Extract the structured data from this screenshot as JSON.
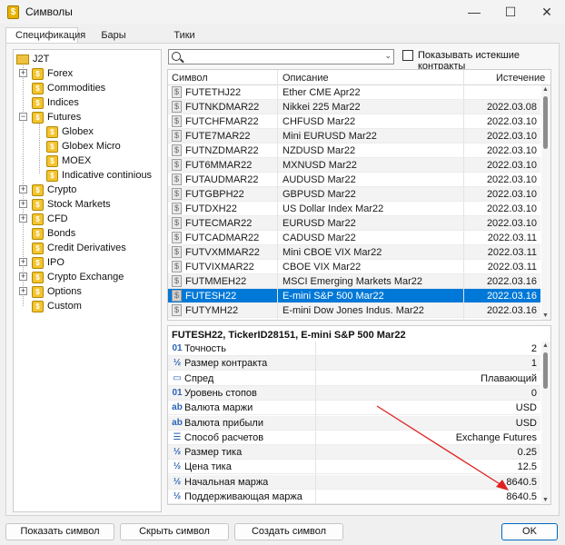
{
  "window": {
    "title": "Символы",
    "minimize": "—",
    "maximize": "☐",
    "close": "✕"
  },
  "tabs": [
    {
      "label": "Спецификация",
      "active": true
    },
    {
      "label": "Бары",
      "active": false
    },
    {
      "label": "Тики",
      "active": false
    }
  ],
  "tree": {
    "root": "J2T",
    "items": [
      {
        "label": "Forex",
        "expander": "+"
      },
      {
        "label": "Commodities",
        "expander": ""
      },
      {
        "label": "Indices",
        "expander": ""
      },
      {
        "label": "Futures",
        "expander": "−"
      },
      {
        "label": "Globex",
        "expander": "",
        "child": true
      },
      {
        "label": "Globex Micro",
        "expander": "",
        "child": true
      },
      {
        "label": "MOEX",
        "expander": "",
        "child": true
      },
      {
        "label": "Indicative continious",
        "expander": "",
        "child": true
      },
      {
        "label": "Crypto",
        "expander": "+"
      },
      {
        "label": "Stock Markets",
        "expander": "+"
      },
      {
        "label": "CFD",
        "expander": "+"
      },
      {
        "label": "Bonds",
        "expander": ""
      },
      {
        "label": "Credit Derivatives",
        "expander": ""
      },
      {
        "label": "IPO",
        "expander": "+"
      },
      {
        "label": "Crypto Exchange",
        "expander": "+"
      },
      {
        "label": "Options",
        "expander": "+"
      },
      {
        "label": "Custom",
        "expander": ""
      }
    ]
  },
  "search": {
    "value": "",
    "placeholder": ""
  },
  "show_expired_label": "Показывать истекшие контракты",
  "symbols": {
    "columns": [
      "Символ",
      "Описание",
      "Истечение"
    ],
    "rows": [
      {
        "symbol": "FUTETHJ22",
        "description": "Ether CME Apr22",
        "expiry": ""
      },
      {
        "symbol": "FUTNKDMAR22",
        "description": "Nikkei 225 Mar22",
        "expiry": "2022.03.08"
      },
      {
        "symbol": "FUTCHFMAR22",
        "description": "CHFUSD Mar22",
        "expiry": "2022.03.10"
      },
      {
        "symbol": "FUTE7MAR22",
        "description": "Mini EURUSD Mar22",
        "expiry": "2022.03.10"
      },
      {
        "symbol": "FUTNZDMAR22",
        "description": "NZDUSD Mar22",
        "expiry": "2022.03.10"
      },
      {
        "symbol": "FUT6MMAR22",
        "description": "MXNUSD Mar22",
        "expiry": "2022.03.10"
      },
      {
        "symbol": "FUTAUDMAR22",
        "description": "AUDUSD Mar22",
        "expiry": "2022.03.10"
      },
      {
        "symbol": "FUTGBPH22",
        "description": "GBPUSD Mar22",
        "expiry": "2022.03.10"
      },
      {
        "symbol": "FUTDXH22",
        "description": "US Dollar Index Mar22",
        "expiry": "2022.03.10"
      },
      {
        "symbol": "FUTECMAR22",
        "description": "EURUSD Mar22",
        "expiry": "2022.03.10"
      },
      {
        "symbol": "FUTCADMAR22",
        "description": "CADUSD Mar22",
        "expiry": "2022.03.11"
      },
      {
        "symbol": "FUTVXMMAR22",
        "description": "Mini CBOE VIX Mar22",
        "expiry": "2022.03.11"
      },
      {
        "symbol": "FUTVIXMAR22",
        "description": "CBOE VIX Mar22",
        "expiry": "2022.03.11"
      },
      {
        "symbol": "FUTMMEH22",
        "description": "MSCI Emerging Markets Mar22",
        "expiry": "2022.03.16"
      },
      {
        "symbol": "FUTESH22",
        "description": "E-mini S&P 500 Mar22",
        "expiry": "2022.03.16",
        "selected": true
      },
      {
        "symbol": "FUTYMH22",
        "description": "E-mini Dow Jones Indus. Mar22",
        "expiry": "2022.03.16"
      }
    ]
  },
  "spec": {
    "title": "FUTESH22, TickerID28151, E-mini S&P 500 Mar22",
    "rows": [
      {
        "icon": "01",
        "label": "Точность",
        "value": "2"
      },
      {
        "icon": "½",
        "label": "Размер контракта",
        "value": "1"
      },
      {
        "icon": "▭",
        "label": "Спред",
        "value": "Плавающий"
      },
      {
        "icon": "01",
        "label": "Уровень стопов",
        "value": "0"
      },
      {
        "icon": "ab",
        "label": "Валюта маржи",
        "value": "USD"
      },
      {
        "icon": "ab",
        "label": "Валюта прибыли",
        "value": "USD"
      },
      {
        "icon": "☰",
        "label": "Способ расчетов",
        "value": "Exchange Futures"
      },
      {
        "icon": "½",
        "label": "Размер тика",
        "value": "0.25"
      },
      {
        "icon": "½",
        "label": "Цена тика",
        "value": "12.5"
      },
      {
        "icon": "½",
        "label": "Начальная маржа",
        "value": "8640.5"
      },
      {
        "icon": "½",
        "label": "Поддерживающая маржа",
        "value": "8640.5"
      }
    ]
  },
  "buttons": {
    "show": "Показать символ",
    "hide": "Скрыть символ",
    "create": "Создать символ",
    "ok": "OK"
  },
  "colors": {
    "selection": "#0078d7",
    "annotation_arrow": "#e02020",
    "folder": "#f4c430"
  }
}
